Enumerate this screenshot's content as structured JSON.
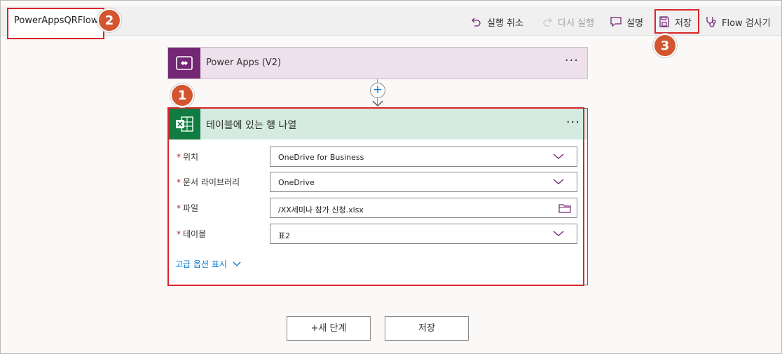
{
  "header": {
    "flow_name": "PowerAppsQRFlow",
    "commands": {
      "undo": "실행 취소",
      "redo": "다시 실행",
      "comment": "설명",
      "save": "저장",
      "checker": "Flow 검사기"
    }
  },
  "badges": [
    "1",
    "2",
    "3"
  ],
  "trigger": {
    "title": "Power Apps (V2)",
    "icon": "power-apps-icon",
    "color": "#742774"
  },
  "action": {
    "title": "테이블에 있는 행 나열",
    "icon": "excel-icon",
    "color": "#107c41",
    "fields": [
      {
        "label": "위치",
        "value": "OneDrive for Business"
      },
      {
        "label": "문서 라이브러리",
        "value": "OneDrive"
      },
      {
        "label": "파일",
        "value": "/XX세미나 참가 신청.xlsx"
      },
      {
        "label": "테이블",
        "value": "표2"
      }
    ],
    "advanced": "고급 옵션 표시"
  },
  "footer": {
    "new_step": "+새 단계",
    "save": "저장"
  },
  "colors": {
    "accent": "#0078d4",
    "badge": "#d35530",
    "highlight": "#d9252a"
  }
}
